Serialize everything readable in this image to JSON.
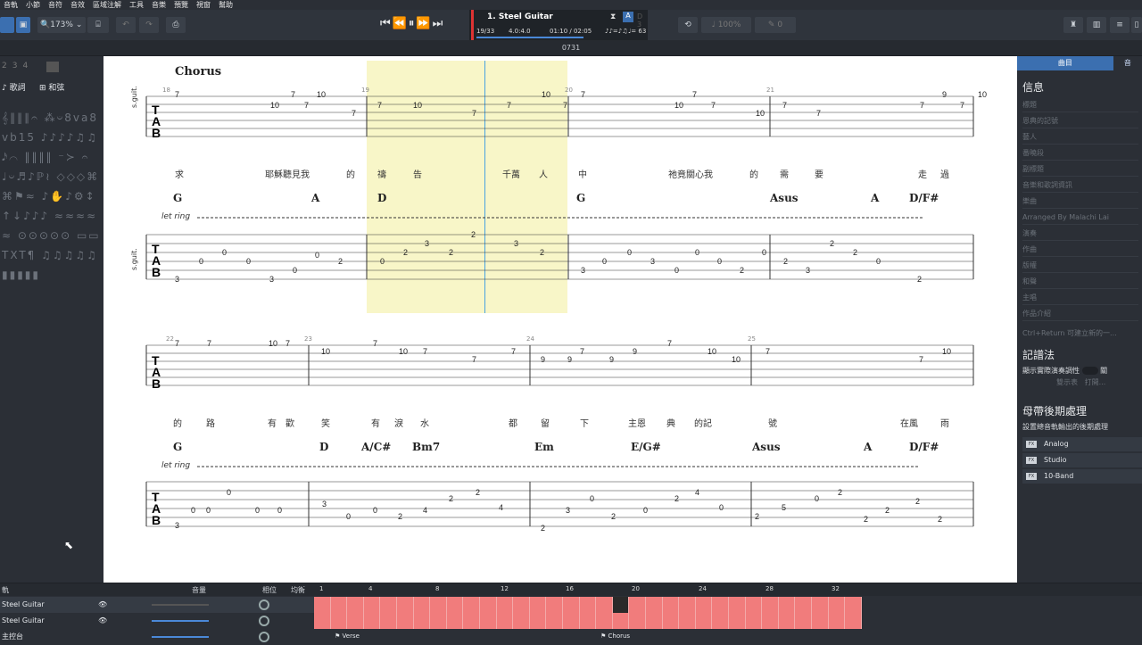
{
  "menu": [
    "音軌",
    "小節",
    "音符",
    "音效",
    "區域注解",
    "工具",
    "音樂",
    "預覽",
    "視窗",
    "幫助"
  ],
  "toolbar": {
    "zoom": "173%",
    "track_name": "1. Steel Guitar",
    "position": "19/33",
    "time_sig": "4.0:4.0",
    "time": "01:10 / 02:05",
    "tempo": "♩= 63",
    "tempo_glyph": "♪♪=♪♫",
    "key": "D 3",
    "volume": "100%",
    "vol_val": "0"
  },
  "document_title": "0731",
  "score": {
    "section_label": "Chorus",
    "instrument_label": "s.guit.",
    "let_ring": "let ring",
    "system1": {
      "measure_numbers": [
        "18",
        "19",
        "20",
        "21"
      ],
      "chords": [
        "G",
        "A",
        "D",
        "G",
        "Asus",
        "A",
        "D/F#"
      ],
      "lyrics": [
        "求",
        "耶穌聽見我",
        "的",
        "禱",
        "告",
        "千萬",
        "人",
        "中",
        "祂竟關心我",
        "的",
        "需",
        "要",
        "走",
        "過"
      ],
      "tab_top": [
        "7",
        "10",
        "7",
        "7",
        "10",
        "7",
        "7",
        "10",
        "7",
        "7",
        "10",
        "7",
        "7",
        "10",
        "7",
        "7",
        "10",
        "7",
        "7",
        "7",
        "9",
        "7",
        "10"
      ],
      "tab_bottom": [
        "3",
        "0",
        "0",
        "0",
        "3",
        "0",
        "0",
        "2",
        "0",
        "2",
        "3",
        "2",
        "2",
        "3",
        "2",
        "3",
        "0",
        "0",
        "3",
        "0",
        "0",
        "0",
        "2",
        "0",
        "2",
        "3",
        "2",
        "2",
        "0",
        "2"
      ]
    },
    "system2": {
      "measure_numbers": [
        "22",
        "23",
        "24",
        "25"
      ],
      "chords": [
        "G",
        "D",
        "A/C#",
        "Bm7",
        "Em",
        "E/G#",
        "Asus",
        "A",
        "D/F#"
      ],
      "lyrics": [
        "的",
        "路",
        "有",
        "歡",
        "笑",
        "有",
        "淚",
        "水",
        "都",
        "留",
        "下",
        "主恩",
        "典",
        "的記",
        "號",
        "在風",
        "雨"
      ],
      "tab_top": [
        "7",
        "7",
        "10",
        "7",
        "10",
        "7",
        "10",
        "7",
        "7",
        "7",
        "9",
        "9",
        "7",
        "9",
        "9",
        "7",
        "10",
        "10",
        "7",
        "7",
        "10"
      ],
      "tab_bottom": [
        "3",
        "0",
        "0",
        "0",
        "0",
        "0",
        "3",
        "0",
        "0",
        "2",
        "4",
        "2",
        "2",
        "4",
        "2",
        "3",
        "0",
        "2",
        "0",
        "2",
        "4",
        "0",
        "2",
        "5",
        "0",
        "2",
        "2",
        "2",
        "2",
        "2"
      ]
    }
  },
  "right_panel": {
    "tabs": [
      "曲目",
      "音"
    ],
    "info_heading": "信息",
    "fields": [
      "標題",
      "恩典的記號",
      "藝人",
      "番曉段",
      "副標題",
      "音樂和歌詞資訊",
      "樂曲",
      "Arranged By Malachi Lai",
      "演奏",
      "作曲",
      "版權",
      "和聲",
      "主唱",
      "作品介紹"
    ],
    "hint": "Ctrl+Return 可建立新的一...",
    "notation_heading": "記譜法",
    "notation_text": "顯示實際演奏調性",
    "notation_off": "關",
    "notation_btn1": "雙示表",
    "notation_btn2": "打開...",
    "master_heading": "母帶後期處理",
    "master_text": "設置總音軌輸出的後期處理",
    "master_items": [
      "Analog",
      "Studio",
      "10-Band"
    ]
  },
  "bottom": {
    "header": "軌",
    "col_volume": "音量",
    "col_phase": "相位",
    "col_eq": "均衡",
    "tracks": [
      "Steel Guitar",
      "Steel Guitar",
      "主控台"
    ],
    "ruler": [
      "1",
      "4",
      "8",
      "12",
      "16",
      "20",
      "24",
      "28",
      "32"
    ],
    "markers": [
      "Verse",
      "Chorus"
    ]
  }
}
